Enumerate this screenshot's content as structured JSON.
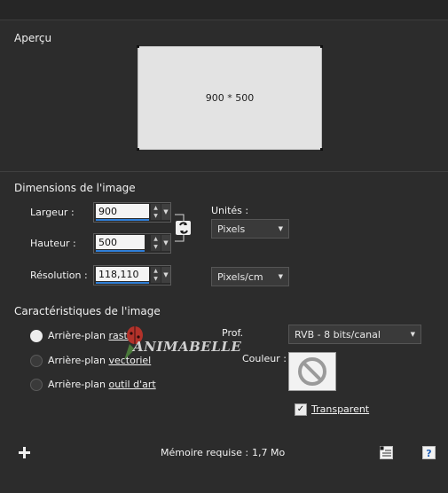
{
  "preview": {
    "title": "Aperçu",
    "size_text": "900 * 500"
  },
  "dimensions": {
    "title": "Dimensions de l'image",
    "width_label": "Largeur :",
    "width_value": "900",
    "height_label": "Hauteur :",
    "height_value": "500",
    "resolution_label": "Résolution :",
    "resolution_value": "118,110",
    "units_label": "Unités :",
    "units_value": "Pixels",
    "resolution_units_value": "Pixels/cm"
  },
  "characteristics": {
    "title": "Caractéristiques de l'image",
    "raster_prefix": "Arrière-plan ",
    "raster_word": "raster",
    "vector_prefix": "Arrière-plan ",
    "vector_word": "vectoriel",
    "art_prefix": "Arrière-plan ",
    "art_word": "outil d'art",
    "depth_label": "Prof.",
    "depth_value": "RVB - 8 bits/canal",
    "color_label": "Couleur :",
    "transparent_prefix": "",
    "transparent_word": "Transparent",
    "selected_background": "raster",
    "transparent_checked": true
  },
  "footer": {
    "memory_label": "Mémoire requise :",
    "memory_value": "1,7 Mo"
  },
  "watermark": "ANIMABELLE",
  "colors": {
    "background": "#2c2c2c",
    "accent": "#2f7fd8",
    "preview_fill": "#e3e3e3"
  }
}
